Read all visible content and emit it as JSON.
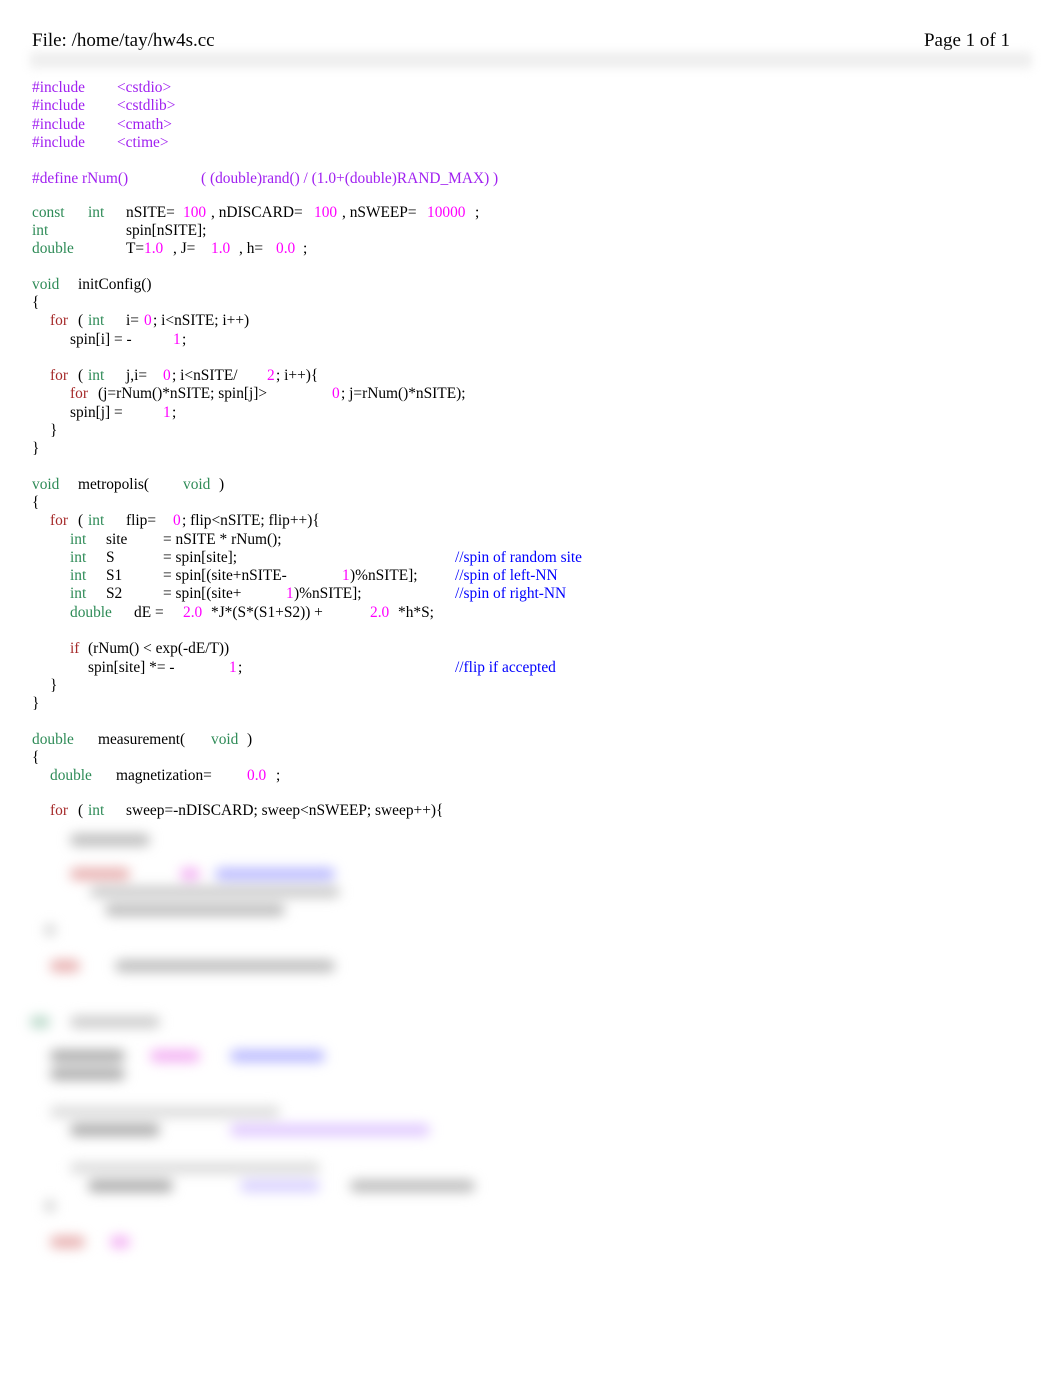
{
  "header": {
    "file_label": "File: /home/tay/hw4s.cc",
    "page_label": "Page 1 of 1"
  },
  "colors": {
    "preprocessor": "#a020f0",
    "type_keyword": "#2e8b57",
    "control_keyword": "#a52a2a",
    "number": "#ff00ff",
    "comment": "#0000ff",
    "text": "#000000"
  },
  "code": {
    "includes": [
      {
        "directive": "#include",
        "header": "<cstdio>"
      },
      {
        "directive": "#include",
        "header": "<cstdlib>"
      },
      {
        "directive": "#include",
        "header": "<cmath>"
      },
      {
        "directive": "#include",
        "header": "<ctime>"
      }
    ],
    "define": {
      "name": "#define rNum()",
      "body": "( (double)rand() / (1.0+(double)RAND_MAX) )"
    },
    "const_line": {
      "kw1": "const",
      "kw2": "int",
      "t1": "nSITE=",
      "n1": "100",
      "t2": ", nDISCARD=",
      "n2": "100",
      "t3": ", nSWEEP=",
      "n3": "10000",
      "t4": ";"
    },
    "int_line": {
      "kw": "int",
      "t": "spin[nSITE];"
    },
    "double_line": {
      "kw": "double",
      "t1": "T=",
      "n1": "1.0",
      "t2": ", J=",
      "n2": "1.0",
      "t3": ", h=",
      "n3": "0.0",
      "t4": ";"
    },
    "initConfig": {
      "sig_kw": "void",
      "sig_name": "initConfig()",
      "open": "{",
      "for1": {
        "ctl": "for",
        "paren": "(",
        "kw": "int",
        "t1": "i=",
        "n1": "0",
        "t2": "; i<nSITE; i++)"
      },
      "assign1": {
        "t": "spin[i] = -",
        "n": "1",
        "end": ";"
      },
      "for2": {
        "ctl": "for",
        "paren": "(",
        "kw": "int",
        "t1": "j,i=",
        "n1": "0",
        "t2": "; i<nSITE/",
        "n2": "2",
        "t3": "; i++){"
      },
      "for3": {
        "ctl": "for",
        "t1": "(j=rNum()*nSITE; spin[j]>",
        "n1": "0",
        "t2": "; j=rNum()*nSITE);"
      },
      "assign2": {
        "t": "spin[j] =",
        "n": "1",
        "end": ";"
      },
      "close_inner": "}",
      "close": "}"
    },
    "metropolis": {
      "sig_kw": "void",
      "sig_name": "metropolis(",
      "sig_arg": "void",
      "sig_end": ")",
      "open": "{",
      "for1": {
        "ctl": "for",
        "paren": "(",
        "kw": "int",
        "t1": "flip=",
        "n1": "0",
        "t2": "; flip<nSITE; flip++){"
      },
      "site": {
        "kw": "int",
        "var": "site",
        "t": "= nSITE * rNum();"
      },
      "S": {
        "kw": "int",
        "var": "S",
        "t": "= spin[site];",
        "comment": "//spin of random site"
      },
      "S1": {
        "kw": "int",
        "var": "S1",
        "t": "= spin[(site+nSITE-",
        "n": "1",
        "t2": ")%nSITE];",
        "comment": "//spin of left-NN"
      },
      "S2": {
        "kw": "int",
        "var": "S2",
        "t": "= spin[(site+",
        "n": "1",
        "t2": ")%nSITE];",
        "comment": "//spin of right-NN"
      },
      "dE": {
        "kw": "double",
        "var": "dE =",
        "n1": "2.0",
        "t1": "*J*(S*(S1+S2)) +",
        "n2": "2.0",
        "t2": "*h*S;"
      },
      "if": {
        "ctl": "if",
        "t": "(rNum() < exp(-dE/T))"
      },
      "flip": {
        "t": "spin[site] *= -",
        "n": "1",
        "end": ";",
        "comment": "//flip if accepted"
      },
      "close_inner": "}",
      "close": "}"
    },
    "measurement": {
      "sig_kw": "double",
      "sig_name": "measurement(",
      "sig_arg": "void",
      "sig_end": ")",
      "open": "{",
      "mag": {
        "kw": "double",
        "t": "magnetization=",
        "n": "0.0",
        "end": ";"
      },
      "for1": {
        "ctl": "for",
        "paren": "(",
        "kw": "int",
        "t1": "sweep=-nDISCARD; sweep<nSWEEP; sweep++){"
      }
    }
  }
}
